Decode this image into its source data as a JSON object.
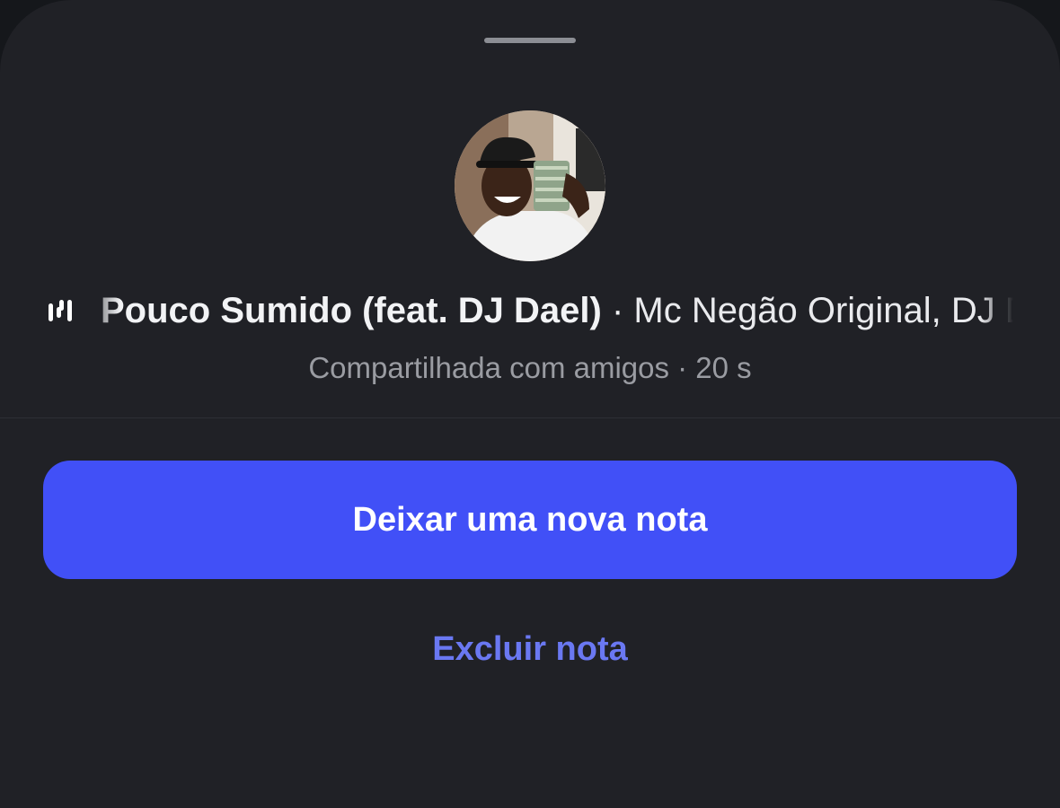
{
  "note": {
    "song_title": "Pouco Sumido (feat. DJ Dael)",
    "separator": " · ",
    "artist": "Mc Negão Original, DJ Dael",
    "subtitle": "Compartilhada com amigos · 20 s",
    "audio_icon": "audio-wave-icon"
  },
  "actions": {
    "primary_label": "Deixar uma nova nota",
    "delete_label": "Excluir nota"
  },
  "colors": {
    "sheet_background": "#202126",
    "primary_button": "#4150f7",
    "delete_link": "#6a78f2",
    "subtitle_text": "#9a9ca2"
  }
}
